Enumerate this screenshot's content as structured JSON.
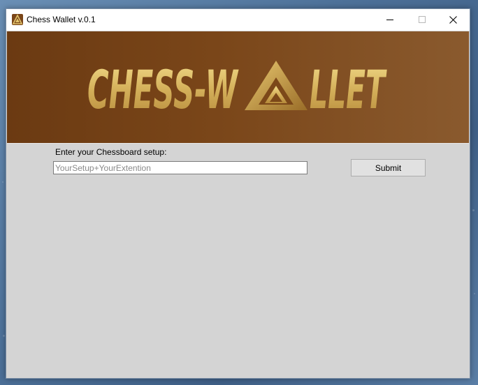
{
  "window": {
    "title": "Chess Wallet v.0.1",
    "icon": "chess-wallet-app-icon"
  },
  "title_controls": {
    "minimize_icon": "minimize-icon",
    "maximize_icon": "maximize-icon",
    "close_icon": "close-icon"
  },
  "banner": {
    "logo_left": "CHESS-W",
    "logo_right": "LLET",
    "logo_mark": "triangle-a-logo"
  },
  "form": {
    "label": "Enter your Chessboard setup:",
    "input_value": "",
    "input_placeholder": "YourSetup+YourExtention",
    "submit_label": "Submit"
  },
  "colors": {
    "banner_bg": "#7a4619",
    "logo_gold": "#d9b860",
    "window_bg": "#d4d4d4"
  }
}
